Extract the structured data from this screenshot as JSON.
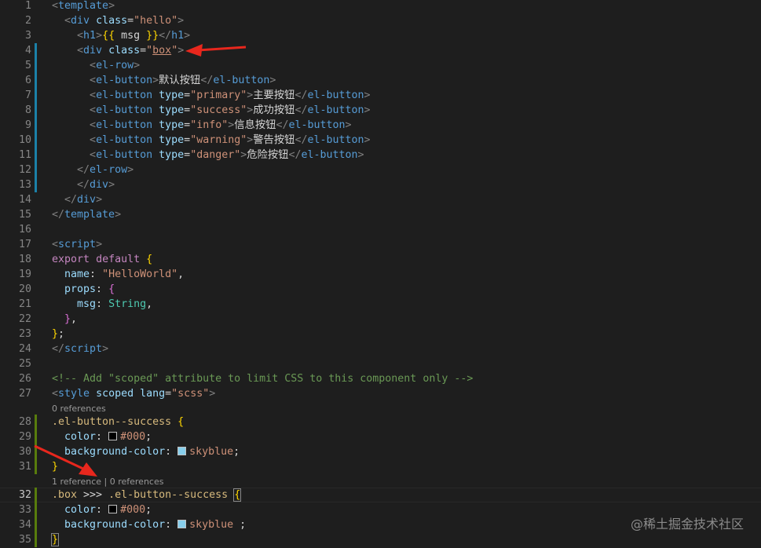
{
  "colors": {
    "background": "#1e1e1e",
    "line_number": "#858585",
    "modified_marker": "#1b81a8",
    "added_marker": "#587c0c",
    "annotation_arrow": "#e8271d"
  },
  "lines": [
    {
      "n": "1",
      "marker": "",
      "tokens": [
        [
          "<",
          "t-tag"
        ],
        [
          "template",
          "t-name"
        ],
        [
          ">",
          "t-tag"
        ]
      ]
    },
    {
      "n": "2",
      "marker": "",
      "tokens": [
        [
          "  ",
          "t-txt"
        ],
        [
          "<",
          "t-tag"
        ],
        [
          "div",
          "t-name"
        ],
        [
          " ",
          "t-txt"
        ],
        [
          "class",
          "t-attr"
        ],
        [
          "=",
          "t-txt"
        ],
        [
          "\"hello\"",
          "t-str"
        ],
        [
          ">",
          "t-tag"
        ]
      ]
    },
    {
      "n": "3",
      "marker": "",
      "tokens": [
        [
          "    ",
          "t-txt"
        ],
        [
          "<",
          "t-tag"
        ],
        [
          "h1",
          "t-name"
        ],
        [
          ">",
          "t-tag"
        ],
        [
          "{{",
          "t-br1"
        ],
        [
          " msg ",
          "t-txt"
        ],
        [
          "}}",
          "t-br1"
        ],
        [
          "</",
          "t-tag"
        ],
        [
          "h1",
          "t-name"
        ],
        [
          ">",
          "t-tag"
        ]
      ]
    },
    {
      "n": "4",
      "marker": "modified",
      "tokens": [
        [
          "    ",
          "t-txt"
        ],
        [
          "<",
          "t-tag"
        ],
        [
          "div",
          "t-name"
        ],
        [
          " ",
          "t-txt"
        ],
        [
          "class",
          "t-attr"
        ],
        [
          "=",
          "t-txt"
        ],
        [
          "\"",
          "t-str"
        ],
        [
          "box",
          "t-str underline"
        ],
        [
          "\"",
          "t-str"
        ],
        [
          ">",
          "t-tag"
        ]
      ]
    },
    {
      "n": "5",
      "marker": "modified",
      "tokens": [
        [
          "      ",
          "t-txt"
        ],
        [
          "<",
          "t-tag"
        ],
        [
          "el-row",
          "t-name"
        ],
        [
          ">",
          "t-tag"
        ]
      ]
    },
    {
      "n": "6",
      "marker": "modified",
      "tokens": [
        [
          "      ",
          "t-txt"
        ],
        [
          "<",
          "t-tag"
        ],
        [
          "el-button",
          "t-name"
        ],
        [
          ">",
          "t-tag"
        ],
        [
          "默认按钮",
          "t-txt"
        ],
        [
          "</",
          "t-tag"
        ],
        [
          "el-button",
          "t-name"
        ],
        [
          ">",
          "t-tag"
        ]
      ]
    },
    {
      "n": "7",
      "marker": "modified",
      "tokens": [
        [
          "      ",
          "t-txt"
        ],
        [
          "<",
          "t-tag"
        ],
        [
          "el-button",
          "t-name"
        ],
        [
          " ",
          "t-txt"
        ],
        [
          "type",
          "t-attr"
        ],
        [
          "=",
          "t-txt"
        ],
        [
          "\"primary\"",
          "t-str"
        ],
        [
          ">",
          "t-tag"
        ],
        [
          "主要按钮",
          "t-txt"
        ],
        [
          "</",
          "t-tag"
        ],
        [
          "el-button",
          "t-name"
        ],
        [
          ">",
          "t-tag"
        ]
      ]
    },
    {
      "n": "8",
      "marker": "modified",
      "tokens": [
        [
          "      ",
          "t-txt"
        ],
        [
          "<",
          "t-tag"
        ],
        [
          "el-button",
          "t-name"
        ],
        [
          " ",
          "t-txt"
        ],
        [
          "type",
          "t-attr"
        ],
        [
          "=",
          "t-txt"
        ],
        [
          "\"success\"",
          "t-str"
        ],
        [
          ">",
          "t-tag"
        ],
        [
          "成功按钮",
          "t-txt"
        ],
        [
          "</",
          "t-tag"
        ],
        [
          "el-button",
          "t-name"
        ],
        [
          ">",
          "t-tag"
        ]
      ]
    },
    {
      "n": "9",
      "marker": "modified",
      "tokens": [
        [
          "      ",
          "t-txt"
        ],
        [
          "<",
          "t-tag"
        ],
        [
          "el-button",
          "t-name"
        ],
        [
          " ",
          "t-txt"
        ],
        [
          "type",
          "t-attr"
        ],
        [
          "=",
          "t-txt"
        ],
        [
          "\"info\"",
          "t-str"
        ],
        [
          ">",
          "t-tag"
        ],
        [
          "信息按钮",
          "t-txt"
        ],
        [
          "</",
          "t-tag"
        ],
        [
          "el-button",
          "t-name"
        ],
        [
          ">",
          "t-tag"
        ]
      ]
    },
    {
      "n": "10",
      "marker": "modified",
      "tokens": [
        [
          "      ",
          "t-txt"
        ],
        [
          "<",
          "t-tag"
        ],
        [
          "el-button",
          "t-name"
        ],
        [
          " ",
          "t-txt"
        ],
        [
          "type",
          "t-attr"
        ],
        [
          "=",
          "t-txt"
        ],
        [
          "\"warning\"",
          "t-str"
        ],
        [
          ">",
          "t-tag"
        ],
        [
          "警告按钮",
          "t-txt"
        ],
        [
          "</",
          "t-tag"
        ],
        [
          "el-button",
          "t-name"
        ],
        [
          ">",
          "t-tag"
        ]
      ]
    },
    {
      "n": "11",
      "marker": "modified",
      "tokens": [
        [
          "      ",
          "t-txt"
        ],
        [
          "<",
          "t-tag"
        ],
        [
          "el-button",
          "t-name"
        ],
        [
          " ",
          "t-txt"
        ],
        [
          "type",
          "t-attr"
        ],
        [
          "=",
          "t-txt"
        ],
        [
          "\"danger\"",
          "t-str"
        ],
        [
          ">",
          "t-tag"
        ],
        [
          "危险按钮",
          "t-txt"
        ],
        [
          "</",
          "t-tag"
        ],
        [
          "el-button",
          "t-name"
        ],
        [
          ">",
          "t-tag"
        ]
      ]
    },
    {
      "n": "12",
      "marker": "modified",
      "tokens": [
        [
          "    ",
          "t-txt"
        ],
        [
          "</",
          "t-tag"
        ],
        [
          "el-row",
          "t-name"
        ],
        [
          ">",
          "t-tag"
        ]
      ]
    },
    {
      "n": "13",
      "marker": "modified",
      "tokens": [
        [
          "    ",
          "t-txt"
        ],
        [
          "</",
          "t-tag"
        ],
        [
          "div",
          "t-name"
        ],
        [
          ">",
          "t-tag"
        ]
      ]
    },
    {
      "n": "14",
      "marker": "",
      "tokens": [
        [
          "  ",
          "t-txt"
        ],
        [
          "</",
          "t-tag"
        ],
        [
          "div",
          "t-name"
        ],
        [
          ">",
          "t-tag"
        ]
      ]
    },
    {
      "n": "15",
      "marker": "",
      "tokens": [
        [
          "</",
          "t-tag"
        ],
        [
          "template",
          "t-name"
        ],
        [
          ">",
          "t-tag"
        ]
      ]
    },
    {
      "n": "16",
      "marker": "",
      "tokens": []
    },
    {
      "n": "17",
      "marker": "",
      "tokens": [
        [
          "<",
          "t-tag"
        ],
        [
          "script",
          "t-name"
        ],
        [
          ">",
          "t-tag"
        ]
      ]
    },
    {
      "n": "18",
      "marker": "",
      "tokens": [
        [
          "export",
          "t-kw"
        ],
        [
          " ",
          "t-txt"
        ],
        [
          "default",
          "t-kw"
        ],
        [
          " ",
          "t-txt"
        ],
        [
          "{",
          "t-br1"
        ]
      ]
    },
    {
      "n": "19",
      "marker": "",
      "tokens": [
        [
          "  ",
          "t-txt"
        ],
        [
          "name",
          "t-attr"
        ],
        [
          ": ",
          "t-txt"
        ],
        [
          "\"HelloWorld\"",
          "t-str"
        ],
        [
          ",",
          "t-txt"
        ]
      ]
    },
    {
      "n": "20",
      "marker": "",
      "tokens": [
        [
          "  ",
          "t-txt"
        ],
        [
          "props",
          "t-attr"
        ],
        [
          ": ",
          "t-txt"
        ],
        [
          "{",
          "t-br2"
        ]
      ]
    },
    {
      "n": "21",
      "marker": "",
      "tokens": [
        [
          "    ",
          "t-txt"
        ],
        [
          "msg",
          "t-attr"
        ],
        [
          ": ",
          "t-txt"
        ],
        [
          "String",
          "t-type"
        ],
        [
          ",",
          "t-txt"
        ]
      ]
    },
    {
      "n": "22",
      "marker": "",
      "tokens": [
        [
          "  ",
          "t-txt"
        ],
        [
          "}",
          "t-br2"
        ],
        [
          ",",
          "t-txt"
        ]
      ]
    },
    {
      "n": "23",
      "marker": "",
      "tokens": [
        [
          "}",
          "t-br1"
        ],
        [
          ";",
          "t-txt"
        ]
      ]
    },
    {
      "n": "24",
      "marker": "",
      "tokens": [
        [
          "</",
          "t-tag"
        ],
        [
          "script",
          "t-name"
        ],
        [
          ">",
          "t-tag"
        ]
      ]
    },
    {
      "n": "25",
      "marker": "",
      "tokens": []
    },
    {
      "n": "26",
      "marker": "",
      "tokens": [
        [
          "<!-- Add \"scoped\" attribute to limit CSS to this component only -->",
          "t-cmt"
        ]
      ]
    },
    {
      "n": "27",
      "marker": "",
      "tokens": [
        [
          "<",
          "t-tag"
        ],
        [
          "style",
          "t-name"
        ],
        [
          " ",
          "t-txt"
        ],
        [
          "scoped",
          "t-attr"
        ],
        [
          " ",
          "t-txt"
        ],
        [
          "lang",
          "t-attr"
        ],
        [
          "=",
          "t-txt"
        ],
        [
          "\"scss\"",
          "t-str"
        ],
        [
          ">",
          "t-tag"
        ]
      ]
    },
    {
      "lens": "0 references"
    },
    {
      "n": "28",
      "marker": "added",
      "tokens": [
        [
          ".el-button--success",
          "t-sel"
        ],
        [
          " ",
          "t-txt"
        ],
        [
          "{",
          "t-br1"
        ]
      ]
    },
    {
      "n": "29",
      "marker": "added",
      "tokens": [
        [
          "  ",
          "t-txt"
        ],
        [
          "color",
          "t-attr"
        ],
        [
          ": ",
          "t-txt"
        ],
        [
          "#000",
          "swatch-black"
        ],
        [
          ";",
          "t-txt"
        ]
      ]
    },
    {
      "n": "30",
      "marker": "added",
      "tokens": [
        [
          "  ",
          "t-txt"
        ],
        [
          "background-color",
          "t-attr"
        ],
        [
          ": ",
          "t-txt"
        ],
        [
          "skyblue",
          "swatch-sky"
        ],
        [
          ";",
          "t-txt"
        ]
      ]
    },
    {
      "n": "31",
      "marker": "added",
      "tokens": [
        [
          "}",
          "t-br1"
        ]
      ]
    },
    {
      "lens": "1 reference | 0 references"
    },
    {
      "n": "32",
      "marker": "added",
      "active": true,
      "tokens": [
        [
          ".box",
          "t-sel"
        ],
        [
          " >>> ",
          "t-txt"
        ],
        [
          ".el-button--success",
          "t-sel"
        ],
        [
          " ",
          "t-txt"
        ],
        [
          "{",
          "t-br1 bracket-box"
        ]
      ]
    },
    {
      "n": "33",
      "marker": "added",
      "tokens": [
        [
          "  ",
          "t-txt"
        ],
        [
          "color",
          "t-attr"
        ],
        [
          ": ",
          "t-txt"
        ],
        [
          "#000",
          "swatch-black"
        ],
        [
          ";",
          "t-txt"
        ]
      ]
    },
    {
      "n": "34",
      "marker": "added",
      "tokens": [
        [
          "  ",
          "t-txt"
        ],
        [
          "background-color",
          "t-attr"
        ],
        [
          ": ",
          "t-txt"
        ],
        [
          "skyblue",
          "swatch-sky"
        ],
        [
          " ;",
          "t-txt"
        ]
      ]
    },
    {
      "n": "35",
      "marker": "added",
      "tokens": [
        [
          "}",
          "t-br1 bracket-box"
        ]
      ]
    }
  ],
  "swatches": {
    "swatch-black": "#000000",
    "swatch-sky": "#87ceeb"
  },
  "watermark": "@稀土掘金技术社区"
}
